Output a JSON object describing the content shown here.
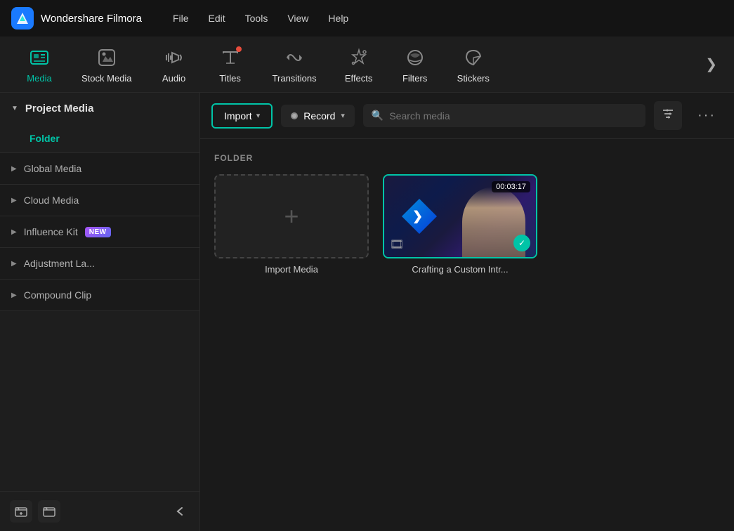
{
  "titleBar": {
    "appName": "Wondershare Filmora",
    "menu": [
      "File",
      "Edit",
      "Tools",
      "View",
      "Help"
    ]
  },
  "toolbar": {
    "items": [
      {
        "id": "media",
        "label": "Media",
        "icon": "media",
        "active": true,
        "badge": false
      },
      {
        "id": "stock-media",
        "label": "Stock Media",
        "icon": "stock",
        "active": false,
        "badge": false
      },
      {
        "id": "audio",
        "label": "Audio",
        "icon": "audio",
        "active": false,
        "badge": false
      },
      {
        "id": "titles",
        "label": "Titles",
        "icon": "titles",
        "active": false,
        "badge": true
      },
      {
        "id": "transitions",
        "label": "Transitions",
        "icon": "transitions",
        "active": false,
        "badge": false
      },
      {
        "id": "effects",
        "label": "Effects",
        "icon": "effects",
        "active": false,
        "badge": false
      },
      {
        "id": "filters",
        "label": "Filters",
        "icon": "filters",
        "active": false,
        "badge": false
      },
      {
        "id": "stickers",
        "label": "Stickers",
        "icon": "stickers",
        "active": false,
        "badge": false
      }
    ],
    "moreLabel": "❯"
  },
  "sidebar": {
    "sections": [
      {
        "id": "project-media",
        "label": "Project Media",
        "expanded": true,
        "subItems": [
          {
            "id": "folder",
            "label": "Folder",
            "active": true
          }
        ]
      },
      {
        "id": "global-media",
        "label": "Global Media",
        "expanded": false
      },
      {
        "id": "cloud-media",
        "label": "Cloud Media",
        "expanded": false
      },
      {
        "id": "influence-kit",
        "label": "Influence Kit",
        "expanded": false,
        "badge": "NEW"
      },
      {
        "id": "adjustment-la",
        "label": "Adjustment La...",
        "expanded": false
      },
      {
        "id": "compound-clip",
        "label": "Compound Clip",
        "expanded": false
      }
    ],
    "footer": {
      "addFolderBtn": "🗁",
      "newFolderBtn": "🗂",
      "collapseBtn": "‹"
    }
  },
  "contentToolbar": {
    "importLabel": "Import",
    "importChevron": "▾",
    "recordLabel": "Record",
    "recordChevron": "▾",
    "searchPlaceholder": "Search media",
    "filterIcon": "filter",
    "moreIcon": "···"
  },
  "mediaGrid": {
    "sectionLabel": "FOLDER",
    "items": [
      {
        "id": "import-media",
        "type": "import",
        "label": "Import Media"
      },
      {
        "id": "crafting-video",
        "type": "video",
        "label": "Crafting a Custom Intr...",
        "duration": "00:03:17",
        "checked": true
      }
    ]
  }
}
